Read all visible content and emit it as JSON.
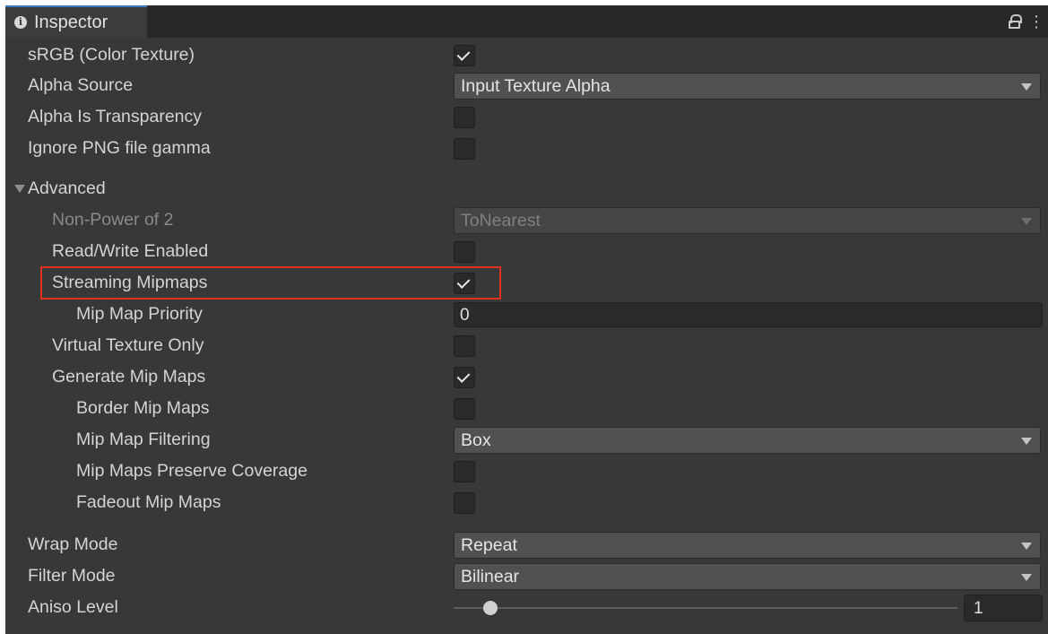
{
  "window": {
    "tab_title": "Inspector",
    "tab_icon": "info-icon",
    "tools": [
      "lock-icon",
      "kebab-menu-icon"
    ]
  },
  "fields": {
    "srgb": {
      "label": "sRGB (Color Texture)",
      "checked": true
    },
    "alpha_source": {
      "label": "Alpha Source",
      "value": "Input Texture Alpha"
    },
    "alpha_is_transparency": {
      "label": "Alpha Is Transparency",
      "checked": false
    },
    "ignore_png_gamma": {
      "label": "Ignore PNG file gamma",
      "checked": false
    },
    "advanced": {
      "label": "Advanced",
      "expanded": true
    },
    "non_power_of_2": {
      "label": "Non-Power of 2",
      "value": "ToNearest",
      "disabled": true
    },
    "read_write": {
      "label": "Read/Write Enabled",
      "checked": false
    },
    "streaming_mipmaps": {
      "label": "Streaming Mipmaps",
      "checked": true,
      "highlighted": true
    },
    "mip_map_priority": {
      "label": "Mip Map Priority",
      "value": "0"
    },
    "virtual_texture_only": {
      "label": "Virtual Texture Only",
      "checked": false
    },
    "generate_mip_maps": {
      "label": "Generate Mip Maps",
      "checked": true
    },
    "border_mip_maps": {
      "label": "Border Mip Maps",
      "checked": false
    },
    "mip_map_filtering": {
      "label": "Mip Map Filtering",
      "value": "Box"
    },
    "mip_maps_preserve_coverage": {
      "label": "Mip Maps Preserve Coverage",
      "checked": false
    },
    "fadeout_mip_maps": {
      "label": "Fadeout Mip Maps",
      "checked": false
    },
    "wrap_mode": {
      "label": "Wrap Mode",
      "value": "Repeat"
    },
    "filter_mode": {
      "label": "Filter Mode",
      "value": "Bilinear"
    },
    "aniso_level": {
      "label": "Aniso Level",
      "value": "1",
      "slider_fraction": 0.06
    }
  },
  "colors": {
    "panel_bg": "#383838",
    "highlight_border": "#e0321e",
    "tab_accent": "#3a79bb"
  }
}
